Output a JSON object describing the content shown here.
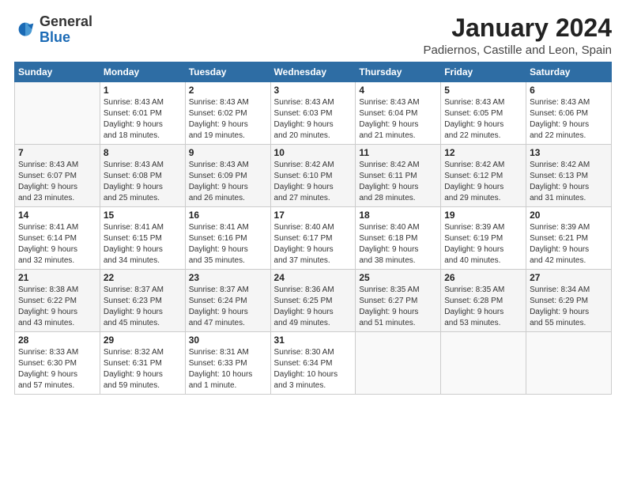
{
  "header": {
    "logo_general": "General",
    "logo_blue": "Blue",
    "month_title": "January 2024",
    "location": "Padiernos, Castille and Leon, Spain"
  },
  "weekdays": [
    "Sunday",
    "Monday",
    "Tuesday",
    "Wednesday",
    "Thursday",
    "Friday",
    "Saturday"
  ],
  "weeks": [
    [
      {
        "day": "",
        "text": ""
      },
      {
        "day": "1",
        "text": "Sunrise: 8:43 AM\nSunset: 6:01 PM\nDaylight: 9 hours\nand 18 minutes."
      },
      {
        "day": "2",
        "text": "Sunrise: 8:43 AM\nSunset: 6:02 PM\nDaylight: 9 hours\nand 19 minutes."
      },
      {
        "day": "3",
        "text": "Sunrise: 8:43 AM\nSunset: 6:03 PM\nDaylight: 9 hours\nand 20 minutes."
      },
      {
        "day": "4",
        "text": "Sunrise: 8:43 AM\nSunset: 6:04 PM\nDaylight: 9 hours\nand 21 minutes."
      },
      {
        "day": "5",
        "text": "Sunrise: 8:43 AM\nSunset: 6:05 PM\nDaylight: 9 hours\nand 22 minutes."
      },
      {
        "day": "6",
        "text": "Sunrise: 8:43 AM\nSunset: 6:06 PM\nDaylight: 9 hours\nand 22 minutes."
      }
    ],
    [
      {
        "day": "7",
        "text": "Sunrise: 8:43 AM\nSunset: 6:07 PM\nDaylight: 9 hours\nand 23 minutes."
      },
      {
        "day": "8",
        "text": "Sunrise: 8:43 AM\nSunset: 6:08 PM\nDaylight: 9 hours\nand 25 minutes."
      },
      {
        "day": "9",
        "text": "Sunrise: 8:43 AM\nSunset: 6:09 PM\nDaylight: 9 hours\nand 26 minutes."
      },
      {
        "day": "10",
        "text": "Sunrise: 8:42 AM\nSunset: 6:10 PM\nDaylight: 9 hours\nand 27 minutes."
      },
      {
        "day": "11",
        "text": "Sunrise: 8:42 AM\nSunset: 6:11 PM\nDaylight: 9 hours\nand 28 minutes."
      },
      {
        "day": "12",
        "text": "Sunrise: 8:42 AM\nSunset: 6:12 PM\nDaylight: 9 hours\nand 29 minutes."
      },
      {
        "day": "13",
        "text": "Sunrise: 8:42 AM\nSunset: 6:13 PM\nDaylight: 9 hours\nand 31 minutes."
      }
    ],
    [
      {
        "day": "14",
        "text": "Sunrise: 8:41 AM\nSunset: 6:14 PM\nDaylight: 9 hours\nand 32 minutes."
      },
      {
        "day": "15",
        "text": "Sunrise: 8:41 AM\nSunset: 6:15 PM\nDaylight: 9 hours\nand 34 minutes."
      },
      {
        "day": "16",
        "text": "Sunrise: 8:41 AM\nSunset: 6:16 PM\nDaylight: 9 hours\nand 35 minutes."
      },
      {
        "day": "17",
        "text": "Sunrise: 8:40 AM\nSunset: 6:17 PM\nDaylight: 9 hours\nand 37 minutes."
      },
      {
        "day": "18",
        "text": "Sunrise: 8:40 AM\nSunset: 6:18 PM\nDaylight: 9 hours\nand 38 minutes."
      },
      {
        "day": "19",
        "text": "Sunrise: 8:39 AM\nSunset: 6:19 PM\nDaylight: 9 hours\nand 40 minutes."
      },
      {
        "day": "20",
        "text": "Sunrise: 8:39 AM\nSunset: 6:21 PM\nDaylight: 9 hours\nand 42 minutes."
      }
    ],
    [
      {
        "day": "21",
        "text": "Sunrise: 8:38 AM\nSunset: 6:22 PM\nDaylight: 9 hours\nand 43 minutes."
      },
      {
        "day": "22",
        "text": "Sunrise: 8:37 AM\nSunset: 6:23 PM\nDaylight: 9 hours\nand 45 minutes."
      },
      {
        "day": "23",
        "text": "Sunrise: 8:37 AM\nSunset: 6:24 PM\nDaylight: 9 hours\nand 47 minutes."
      },
      {
        "day": "24",
        "text": "Sunrise: 8:36 AM\nSunset: 6:25 PM\nDaylight: 9 hours\nand 49 minutes."
      },
      {
        "day": "25",
        "text": "Sunrise: 8:35 AM\nSunset: 6:27 PM\nDaylight: 9 hours\nand 51 minutes."
      },
      {
        "day": "26",
        "text": "Sunrise: 8:35 AM\nSunset: 6:28 PM\nDaylight: 9 hours\nand 53 minutes."
      },
      {
        "day": "27",
        "text": "Sunrise: 8:34 AM\nSunset: 6:29 PM\nDaylight: 9 hours\nand 55 minutes."
      }
    ],
    [
      {
        "day": "28",
        "text": "Sunrise: 8:33 AM\nSunset: 6:30 PM\nDaylight: 9 hours\nand 57 minutes."
      },
      {
        "day": "29",
        "text": "Sunrise: 8:32 AM\nSunset: 6:31 PM\nDaylight: 9 hours\nand 59 minutes."
      },
      {
        "day": "30",
        "text": "Sunrise: 8:31 AM\nSunset: 6:33 PM\nDaylight: 10 hours\nand 1 minute."
      },
      {
        "day": "31",
        "text": "Sunrise: 8:30 AM\nSunset: 6:34 PM\nDaylight: 10 hours\nand 3 minutes."
      },
      {
        "day": "",
        "text": ""
      },
      {
        "day": "",
        "text": ""
      },
      {
        "day": "",
        "text": ""
      }
    ]
  ]
}
